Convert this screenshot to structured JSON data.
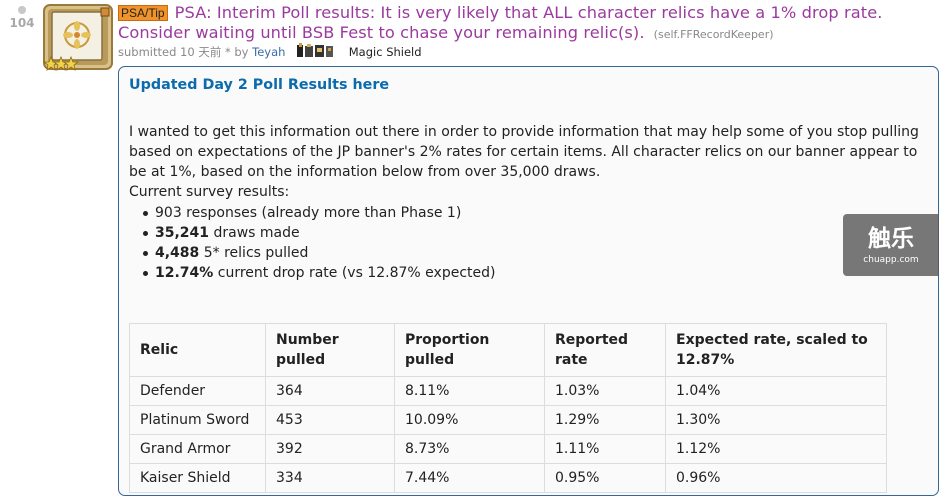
{
  "vote": {
    "score": "104"
  },
  "post": {
    "flair": "PSA/Tip",
    "title": "PSA: Interim Poll results: It is very likely that ALL character relics have a 1% drop rate. Consider waiting until BSB Fest to chase your remaining relic(s).",
    "domain": "(self.FFRecordKeeper)",
    "submitted_prefix": "submitted 10 天前 * by",
    "author": "Teyah",
    "user_flair": "Magic Shield"
  },
  "body": {
    "link_text": "Updated Day 2 Poll Results here",
    "intro": "I wanted to get this information out there in order to provide information that may help some of you stop pulling based on expectations of the JP banner's 2% rates for certain items. All character relics on our banner appear to be at 1%, based on the information below from over 35,000 draws.",
    "survey_label": "Current survey results:",
    "bullets": [
      {
        "bold": "",
        "text": "903 responses (already more than Phase 1)"
      },
      {
        "bold": "35,241",
        "text": " draws made"
      },
      {
        "bold": "4,488",
        "text": " 5* relics pulled"
      },
      {
        "bold": "12.74%",
        "text": " current drop rate (vs 12.87% expected)"
      }
    ]
  },
  "table": {
    "headers": [
      "Relic",
      "Number pulled",
      "Proportion pulled",
      "Reported rate",
      "Expected rate, scaled to 12.87%"
    ],
    "rows": [
      [
        "Defender",
        "364",
        "8.11%",
        "1.03%",
        "1.04%"
      ],
      [
        "Platinum Sword",
        "453",
        "10.09%",
        "1.29%",
        "1.30%"
      ],
      [
        "Grand Armor",
        "392",
        "8.73%",
        "1.11%",
        "1.12%"
      ],
      [
        "Kaiser Shield",
        "334",
        "7.44%",
        "0.95%",
        "0.96%"
      ]
    ]
  },
  "watermark": {
    "main": "触乐",
    "sub": "chuapp.com"
  },
  "colors": {
    "title": "#9b3a9e",
    "flair_bg": "#f0932b",
    "link": "#0b6bad",
    "border": "#336699"
  }
}
